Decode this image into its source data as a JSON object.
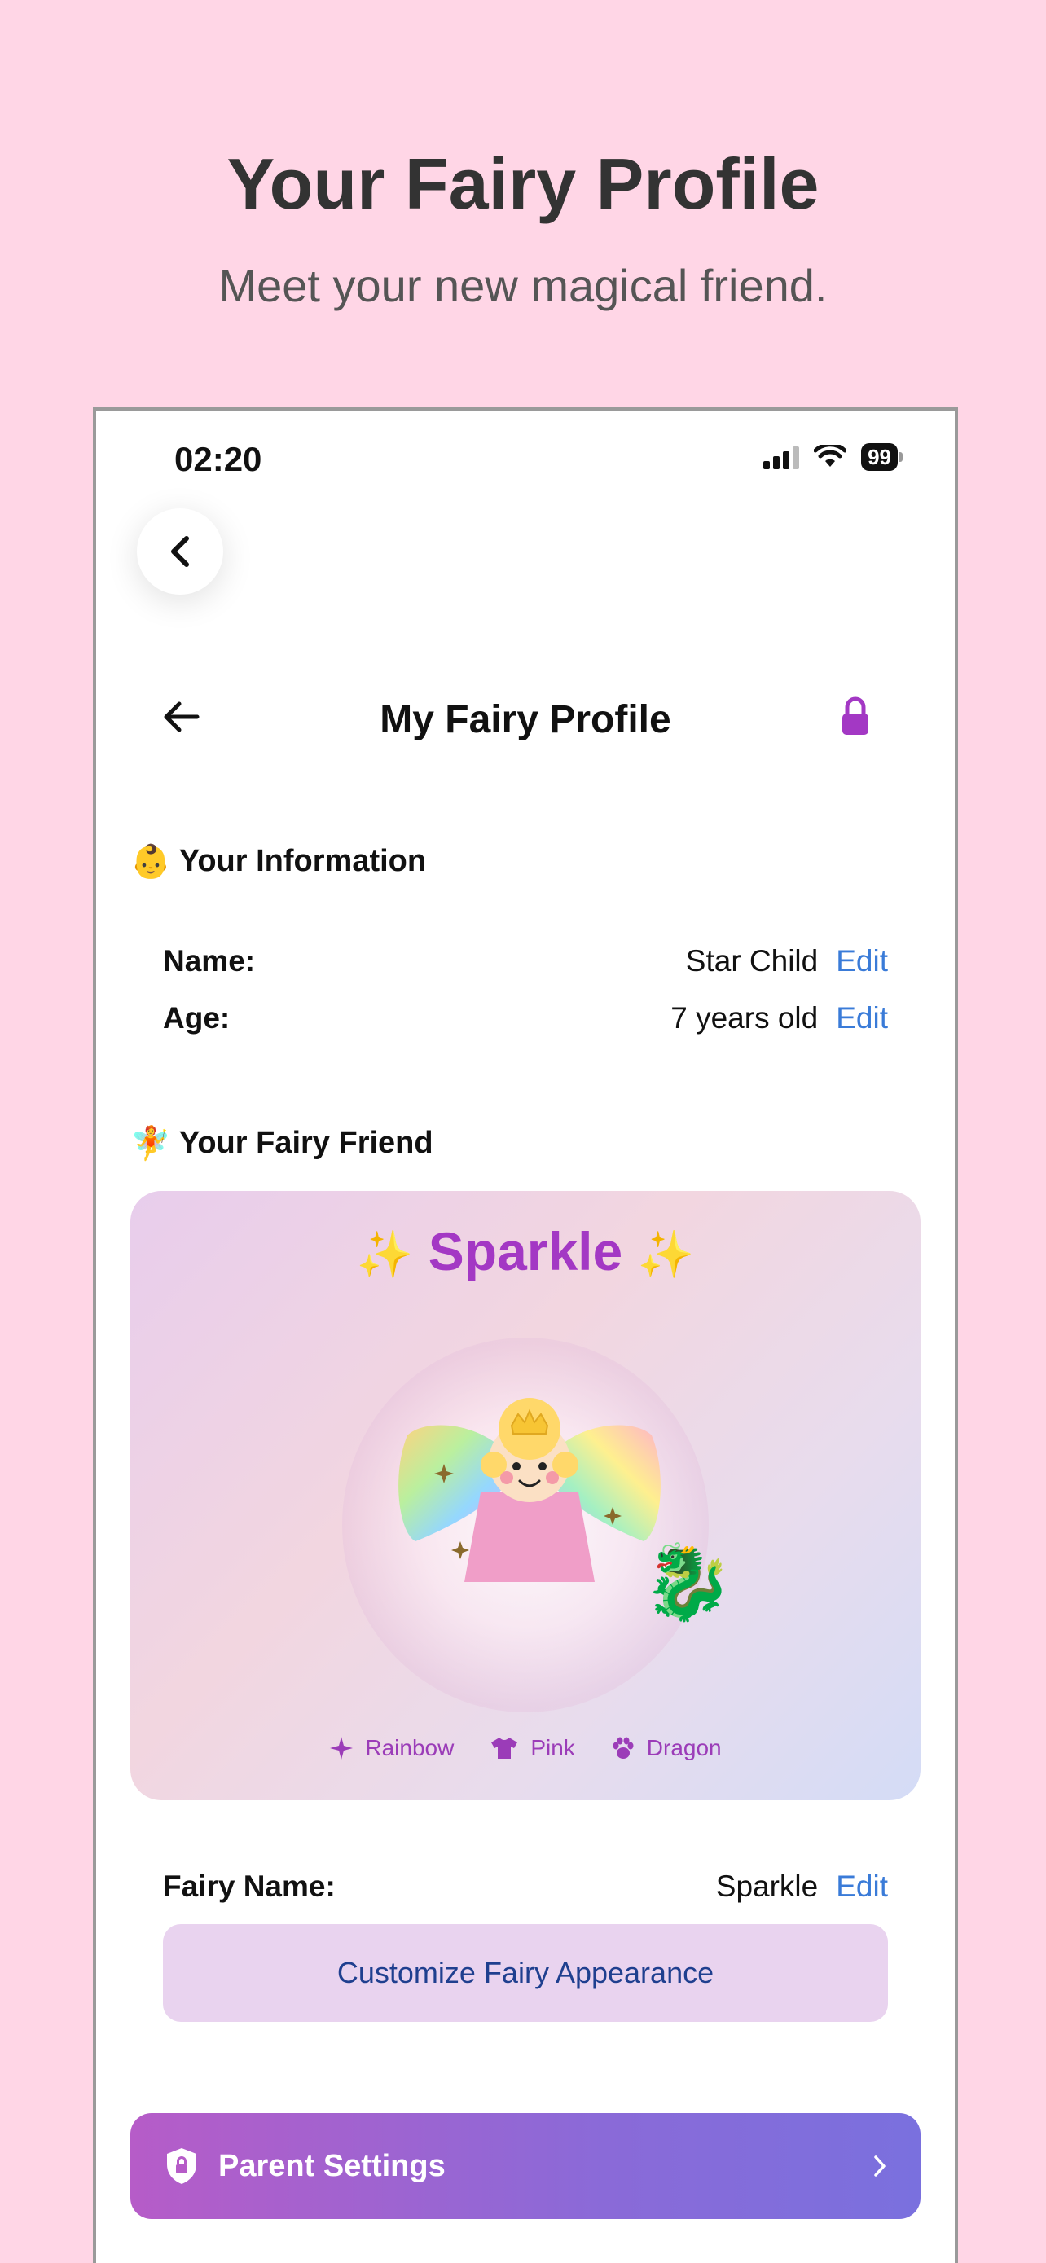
{
  "promo": {
    "title": "Your Fairy Profile",
    "subtitle": "Meet your new magical friend."
  },
  "status_bar": {
    "time": "02:20",
    "battery": "99"
  },
  "nav": {
    "title": "My Fairy Profile"
  },
  "your_information": {
    "emoji": "👶",
    "header": "Your Information",
    "rows": [
      {
        "label": "Name:",
        "value": "Star Child",
        "edit": "Edit"
      },
      {
        "label": "Age:",
        "value": "7 years old",
        "edit": "Edit"
      }
    ]
  },
  "fairy_friend": {
    "emoji": "🧚",
    "header": "Your Fairy Friend",
    "card": {
      "sparkle_left": "✨",
      "name": "Sparkle",
      "sparkle_right": "✨",
      "dragon_emoji": "🐉",
      "tags": [
        {
          "icon": "sparkle-icon",
          "label": "Rainbow"
        },
        {
          "icon": "shirt-icon",
          "label": "Pink"
        },
        {
          "icon": "paw-icon",
          "label": "Dragon"
        }
      ]
    },
    "fairy_name_row": {
      "label": "Fairy Name:",
      "value": "Sparkle",
      "edit": "Edit"
    },
    "customize_button": "Customize Fairy Appearance"
  },
  "parent_settings": {
    "label": "Parent Settings"
  },
  "colors": {
    "background": "#ffd6e6",
    "accent_purple": "#a338c4",
    "link_blue": "#3a7bd8",
    "button_gradient_start": "#b65cc8",
    "button_gradient_end": "#7a70de"
  }
}
